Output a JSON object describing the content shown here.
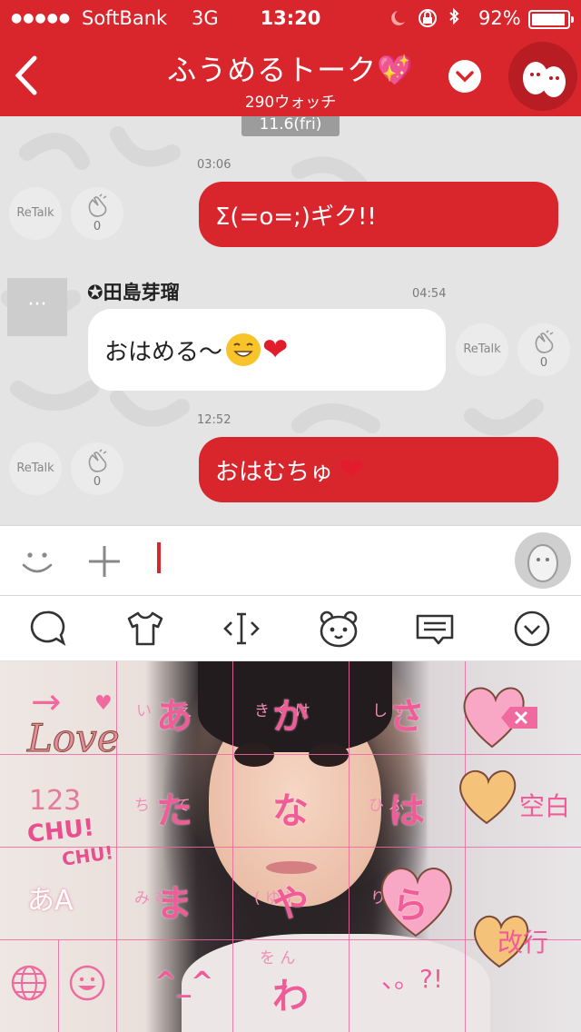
{
  "status_bar": {
    "carrier": "SoftBank",
    "network": "3G",
    "time": "13:20",
    "battery": "92%",
    "battery_level": 0.92
  },
  "header": {
    "title": "ふうめるトーク💖",
    "subtitle": "290ウォッチ"
  },
  "chat": {
    "date_label": "11.6(fri)",
    "retalk_label": "ReTalk",
    "messages": [
      {
        "time": "03:06",
        "text": "Σ(=o=;)ギク!!",
        "clap_count": "0"
      },
      {
        "sender": "✪田島芽瑠",
        "time": "04:54",
        "text": "おはめる〜",
        "clap_count": "0"
      },
      {
        "time": "12:52",
        "text": "おはむちゅ",
        "clap_count": "0"
      }
    ],
    "sender_avatar_dots": "···"
  },
  "keyboard": {
    "keys": {
      "a": "あ",
      "ka": "か",
      "sa": "さ",
      "ta": "た",
      "na": "な",
      "ha": "は",
      "ma": "ま",
      "ya": "や",
      "ra": "ら",
      "kaomoji": "^_^",
      "wa": "わ",
      "punct": "、。?!"
    },
    "sub_a": "い う え",
    "sub_ka": "き く け",
    "sub_sa": "し す",
    "sub_ta": "ち つ て",
    "sub_ha": "ひ ふ",
    "sub_ma": "み む",
    "sub_ya": "( ゆ )",
    "sub_ra": "り れ",
    "sub_wa": "を ん",
    "arrow_label": "→",
    "numbers_label": "123",
    "mode_label": "あA",
    "space_label": "空白",
    "enter_label": "改行",
    "sticker_love": "Love",
    "sticker_chu": "CHU!",
    "sticker_chu2": "CHU!"
  },
  "colors": {
    "brand": "#d9262d",
    "chat_bg": "#e4e4e4",
    "key_pink": "#f05c97"
  }
}
